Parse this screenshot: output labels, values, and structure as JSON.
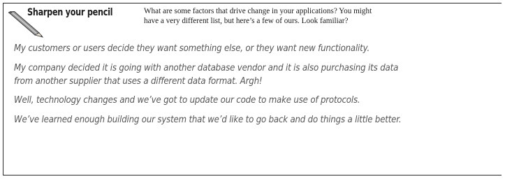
{
  "heading": "Sharpen your pencil",
  "intro_line1": "What are some factors that drive change in your applications? You might",
  "intro_line2": "have a very different list, but here’s a few of ours. Look familiar?",
  "answers": [
    "My customers or users decide they want something else, or they want new functionality.",
    "My company decided it is going with another database vendor and it is also purchasing its data",
    "from another supplier that uses a different data format. Argh!",
    "Well, technology changes and we’ve got to update our code to make use of protocols.",
    "We’ve learned enough building our system that we’d like to go back and do things a little better."
  ],
  "icon": "pencil-icon",
  "colors": {
    "border": "#2a2a2a",
    "heading": "#1c1c1c",
    "intro_text": "#1a1a1a",
    "answer_text": "#555555"
  }
}
